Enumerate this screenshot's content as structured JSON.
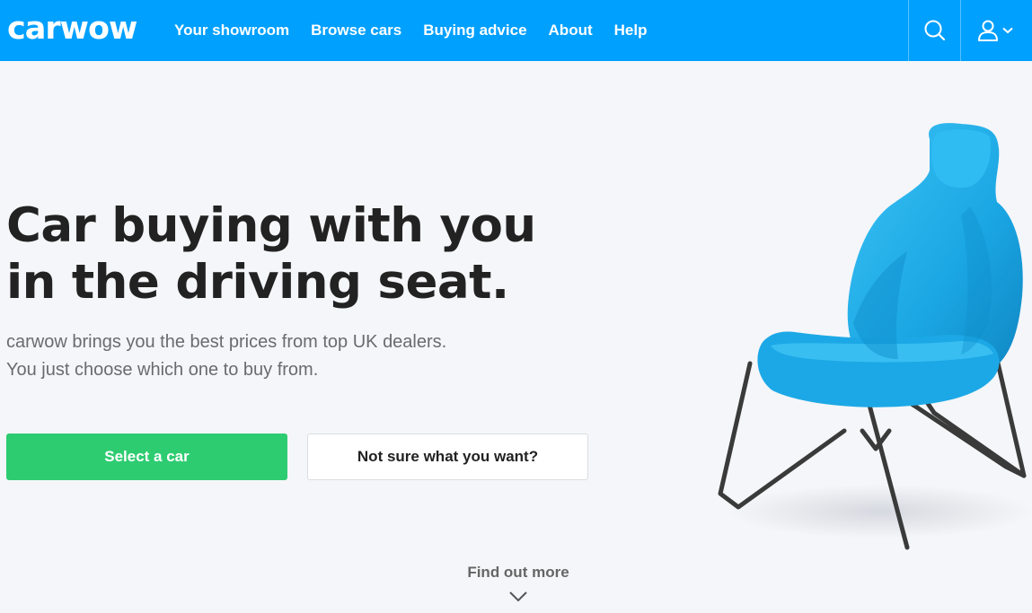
{
  "header": {
    "logo_text": "carwow",
    "nav": [
      {
        "label": "Your showroom"
      },
      {
        "label": "Browse cars"
      },
      {
        "label": "Buying advice"
      },
      {
        "label": "About"
      },
      {
        "label": "Help"
      }
    ],
    "icons": [
      "search-icon",
      "user-icon",
      "chevron-down-icon"
    ],
    "brand_color": "#00a0ff"
  },
  "hero": {
    "headline_line1": "Car buying with you",
    "headline_line2": "in the driving seat.",
    "subtext_line1": "carwow brings you the best prices from top UK dealers.",
    "subtext_line2": "You just choose which one to buy from.",
    "primary_button": "Select a car",
    "secondary_button": "Not sure what you want?",
    "primary_color": "#2ecc71",
    "find_more": "Find out more",
    "illustration_icon": "car-seat-chair-illustration",
    "seat_color": "#1fa9e6"
  }
}
